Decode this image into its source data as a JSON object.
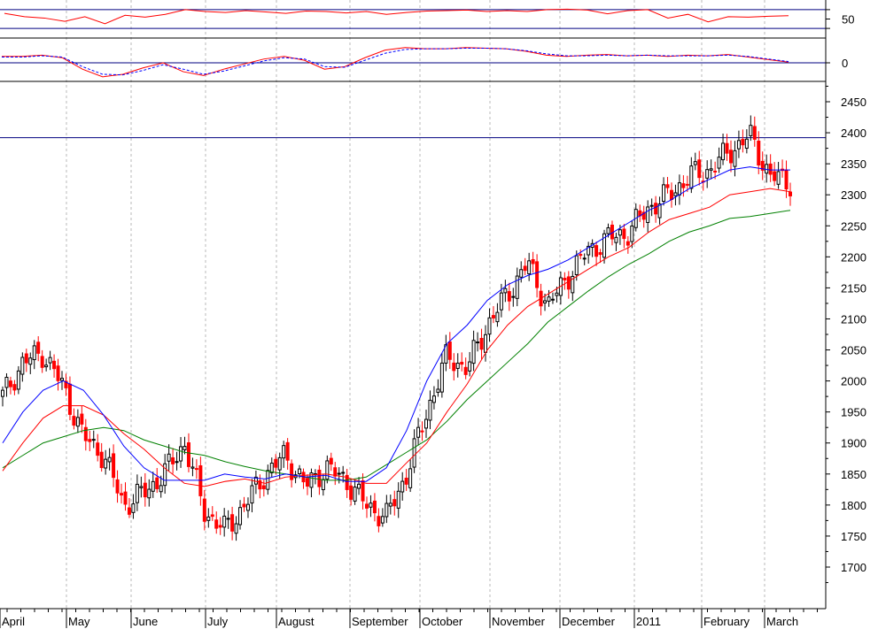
{
  "colors": {
    "background": "#ffffff",
    "grid": "#b8b8b8",
    "axis": "#000000",
    "up_candle": "#000000",
    "down_candle": "#ff0000",
    "ma_short": "#0000ff",
    "ma_mid": "#ff0000",
    "ma_long": "#008000",
    "oscillator_signal": "#0000ff",
    "reference_line": "#000080"
  },
  "chart_data": [
    {
      "type": "line",
      "panel": "oscillator",
      "yticks": [
        "50"
      ],
      "reference_levels": [
        70,
        30
      ],
      "ylim": [
        0,
        100
      ],
      "series": [
        {
          "values_by_month": [
            62,
            55,
            52,
            45,
            55,
            40,
            58,
            54,
            60,
            70,
            66,
            64,
            68,
            65,
            62,
            67,
            66,
            63,
            66,
            60,
            64,
            67,
            68,
            69,
            66,
            68,
            66,
            70,
            71,
            69,
            61,
            68,
            70,
            52,
            60,
            44,
            55,
            54,
            56,
            57
          ]
        }
      ]
    },
    {
      "type": "line",
      "panel": "macd",
      "yticks": [
        "0"
      ],
      "ylim": [
        -30,
        40
      ],
      "series": [
        {
          "values": [
            10,
            10,
            12,
            8,
            -10,
            -22,
            -18,
            -8,
            0,
            -14,
            -20,
            -10,
            -2,
            6,
            10,
            4,
            -10,
            -6,
            8,
            20,
            24,
            22,
            22,
            24,
            23,
            22,
            18,
            12,
            10,
            12,
            13,
            11,
            12,
            10,
            12,
            11,
            13,
            9,
            5,
            1
          ]
        },
        {
          "values": [
            9,
            9,
            11,
            9,
            -6,
            -18,
            -19,
            -12,
            -3,
            -10,
            -18,
            -13,
            -5,
            3,
            8,
            6,
            -6,
            -7,
            4,
            15,
            21,
            22,
            22,
            23,
            23,
            22,
            19,
            14,
            11,
            11,
            12,
            11,
            12,
            11,
            11,
            11,
            12,
            10,
            6,
            2
          ]
        }
      ]
    },
    {
      "type": "candlestick",
      "panel": "price",
      "x_tick_labels": [
        "April",
        "May",
        "June",
        "July",
        "August",
        "September",
        "October",
        "November",
        "December",
        "2011",
        "February",
        "March"
      ],
      "yticks": [
        "2450",
        "2400",
        "2350",
        "2300",
        "2250",
        "2200",
        "2150",
        "2100",
        "2050",
        "2000",
        "1950",
        "1900",
        "1850",
        "1800",
        "1750",
        "1700"
      ],
      "ylim": [
        1650,
        2470
      ],
      "reference_level": 2392,
      "close_by_week": [
        1975,
        2030,
        2045,
        1990,
        1910,
        1880,
        1800,
        1820,
        1850,
        1900,
        1790,
        1760,
        1800,
        1850,
        1880,
        1830,
        1860,
        1840,
        1800,
        1780,
        1850,
        1950,
        2040,
        2020,
        2090,
        2140,
        2190,
        2120,
        2170,
        2210,
        2230,
        2240,
        2280,
        2300,
        2330,
        2340,
        2370,
        2395,
        2330,
        2320
      ],
      "ma_short_values": [
        1900,
        1950,
        1985,
        2000,
        1985,
        1945,
        1895,
        1860,
        1840,
        1840,
        1840,
        1850,
        1845,
        1842,
        1850,
        1845,
        1848,
        1838,
        1838,
        1860,
        1920,
        2000,
        2060,
        2090,
        2130,
        2155,
        2170,
        2180,
        2195,
        2215,
        2235,
        2255,
        2275,
        2290,
        2310,
        2325,
        2340,
        2345,
        2340,
        2340
      ],
      "ma_mid_values": [
        1855,
        1900,
        1940,
        1960,
        1960,
        1945,
        1915,
        1890,
        1860,
        1835,
        1830,
        1838,
        1842,
        1835,
        1845,
        1848,
        1850,
        1845,
        1835,
        1835,
        1868,
        1900,
        1950,
        1995,
        2050,
        2090,
        2120,
        2140,
        2160,
        2180,
        2200,
        2215,
        2240,
        2260,
        2270,
        2280,
        2300,
        2305,
        2310,
        2305
      ],
      "ma_long_values": [
        1860,
        1880,
        1900,
        1910,
        1920,
        1925,
        1920,
        1905,
        1895,
        1885,
        1880,
        1870,
        1862,
        1855,
        1850,
        1845,
        1840,
        1840,
        1845,
        1865,
        1885,
        1905,
        1935,
        1970,
        2000,
        2030,
        2060,
        2095,
        2120,
        2145,
        2168,
        2188,
        2205,
        2225,
        2240,
        2250,
        2262,
        2265,
        2270,
        2275
      ]
    }
  ]
}
